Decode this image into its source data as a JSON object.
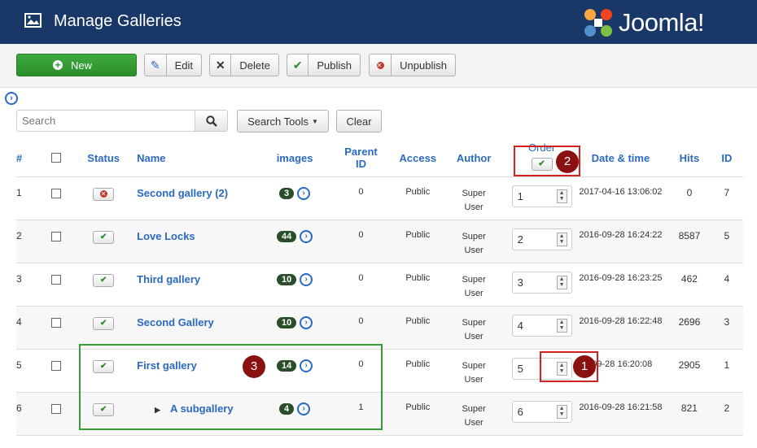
{
  "header": {
    "title": "Manage Galleries",
    "logo_text": "Joomla!"
  },
  "toolbar": {
    "new": "New",
    "edit": "Edit",
    "delete": "Delete",
    "publish": "Publish",
    "unpublish": "Unpublish"
  },
  "filters": {
    "search_placeholder": "Search",
    "search_tools": "Search Tools",
    "clear": "Clear"
  },
  "columns": {
    "num": "#",
    "status": "Status",
    "name": "Name",
    "images": "images",
    "parent_id_1": "Parent",
    "parent_id_2": "ID",
    "access": "Access",
    "author": "Author",
    "order": "Order",
    "date": "Date & time",
    "hits": "Hits",
    "id": "ID"
  },
  "rows": [
    {
      "num": "1",
      "status": "unpublished",
      "name": "Second gallery (2)",
      "images": "3",
      "parent": "0",
      "access": "Public",
      "author_1": "Super",
      "author_2": "User",
      "order": "1",
      "date": "2017-04-16 13:06:02",
      "hits": "0",
      "id": "7"
    },
    {
      "num": "2",
      "status": "published",
      "name": "Love Locks",
      "images": "44",
      "parent": "0",
      "access": "Public",
      "author_1": "Super",
      "author_2": "User",
      "order": "2",
      "date": "2016-09-28 16:24:22",
      "hits": "8587",
      "id": "5"
    },
    {
      "num": "3",
      "status": "published",
      "name": "Third gallery",
      "images": "10",
      "parent": "0",
      "access": "Public",
      "author_1": "Super",
      "author_2": "User",
      "order": "3",
      "date": "2016-09-28 16:23:25",
      "hits": "462",
      "id": "4"
    },
    {
      "num": "4",
      "status": "published",
      "name": "Second Gallery",
      "images": "10",
      "parent": "0",
      "access": "Public",
      "author_1": "Super",
      "author_2": "User",
      "order": "4",
      "date": "2016-09-28 16:22:48",
      "hits": "2696",
      "id": "3"
    },
    {
      "num": "5",
      "status": "published",
      "name": "First gallery",
      "images": "14",
      "parent": "0",
      "access": "Public",
      "author_1": "Super",
      "author_2": "User",
      "order": "5",
      "date": "-09-28 16:20:08",
      "hits": "2905",
      "id": "1"
    },
    {
      "num": "6",
      "status": "published",
      "name": "A subgallery",
      "images": "4",
      "parent": "1",
      "access": "Public",
      "author_1": "Super",
      "author_2": "User",
      "order": "6",
      "date": "2016-09-28 16:21:58",
      "hits": "821",
      "id": "2"
    }
  ],
  "callouts": {
    "c1": "1",
    "c2": "2",
    "c3": "3"
  },
  "colors": {
    "header_bg": "#1a3867",
    "new_btn": "#2d942d",
    "link": "#2a6ac0",
    "badge": "#2a4e2a",
    "callout": "#8b1010"
  }
}
